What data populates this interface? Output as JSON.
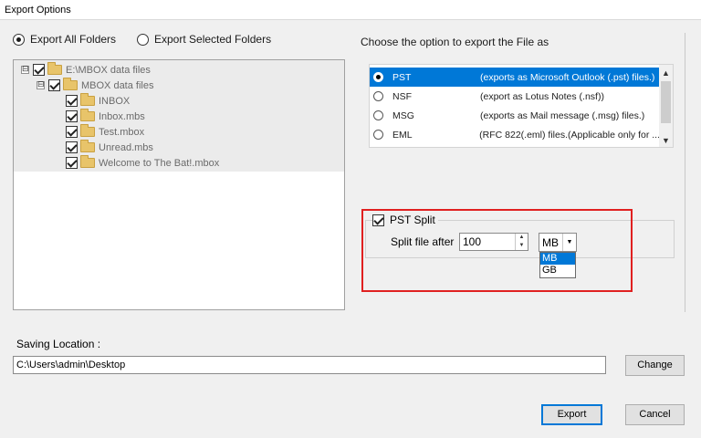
{
  "window": {
    "title": "Export Options"
  },
  "folder_scope": {
    "all_label": "Export All Folders",
    "selected_label": "Export Selected Folders",
    "selected": "all"
  },
  "tree": [
    {
      "label": "E:\\MBOX data files",
      "level": 0,
      "expander": "⊟",
      "checked": true
    },
    {
      "label": "MBOX data files",
      "level": 1,
      "expander": "⊟",
      "checked": true
    },
    {
      "label": "INBOX",
      "level": 2,
      "checked": true
    },
    {
      "label": "Inbox.mbs",
      "level": 2,
      "checked": true
    },
    {
      "label": "Test.mbox",
      "level": 2,
      "checked": true
    },
    {
      "label": "Unread.mbs",
      "level": 2,
      "checked": true
    },
    {
      "label": "Welcome to The Bat!.mbox",
      "level": 2,
      "checked": true
    }
  ],
  "export_format": {
    "heading": "Choose the option to export the File as",
    "options": [
      {
        "name": "PST",
        "desc": "(exports as Microsoft Outlook (.pst) files.)",
        "selected": true
      },
      {
        "name": "NSF",
        "desc": "(export as Lotus Notes (.nsf))",
        "selected": false
      },
      {
        "name": "MSG",
        "desc": "(exports as Mail message (.msg) files.)",
        "selected": false
      },
      {
        "name": "EML",
        "desc": "(RFC 822(.eml) files.(Applicable only for ...",
        "selected": false
      }
    ]
  },
  "pst_split": {
    "label": "PST Split",
    "checked": true,
    "split_after_label": "Split file after",
    "value": "100",
    "unit": "MB",
    "unit_options": [
      "MB",
      "GB"
    ],
    "highlighted_option": "MB"
  },
  "saving": {
    "label": "Saving Location :",
    "path": "C:\\Users\\admin\\Desktop",
    "change_label": "Change"
  },
  "actions": {
    "export_label": "Export",
    "cancel_label": "Cancel"
  },
  "colors": {
    "selection": "#0078d7",
    "highlight_box": "#e02020"
  }
}
